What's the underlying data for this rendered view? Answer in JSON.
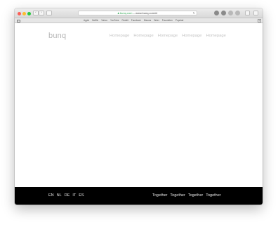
{
  "browser": {
    "url_secure_label": "bunq.com",
    "url_text": " – www.bunq.com/nl",
    "favorites": [
      "Apple",
      "Netflix",
      "Yahoo",
      "YouTube",
      "Reddit",
      "Facebook",
      "Nieuws",
      "Weer",
      "Favorieten",
      "Populair"
    ]
  },
  "page": {
    "logo": "bunq",
    "nav": [
      "Homepage",
      "Homepage",
      "Homepage",
      "Homepage",
      "Homepage"
    ],
    "footer": {
      "languages": [
        "EN",
        "NL",
        "DE",
        "IT",
        "ES"
      ],
      "links": [
        "Together",
        "Together",
        "Together",
        "Together"
      ]
    }
  }
}
